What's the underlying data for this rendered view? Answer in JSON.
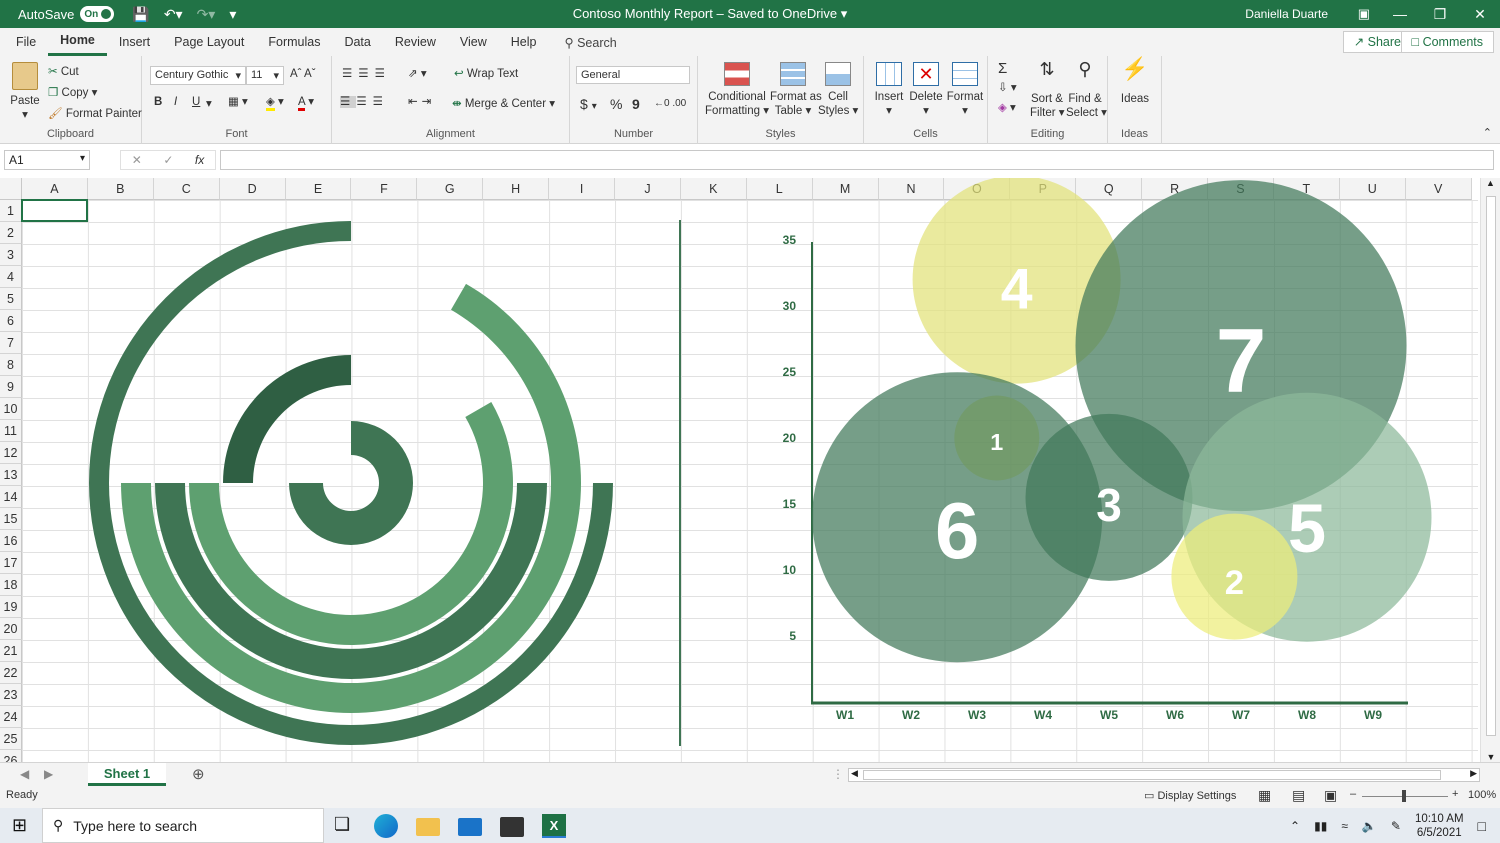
{
  "titlebar": {
    "autosave_label": "AutoSave",
    "autosave_state": "On",
    "title": "Contoso Monthly Report – Saved to OneDrive",
    "user": "Daniella Duarte"
  },
  "menu": {
    "tabs": [
      "File",
      "Home",
      "Insert",
      "Page Layout",
      "Formulas",
      "Data",
      "Review",
      "View",
      "Help"
    ],
    "active_tab": "Home",
    "search": "Search",
    "share": "Share",
    "comments": "Comments"
  },
  "ribbon": {
    "clipboard": {
      "paste": "Paste",
      "cut": "Cut",
      "copy": "Copy",
      "format_painter": "Format Painter",
      "label": "Clipboard"
    },
    "font": {
      "family": "Century Gothic",
      "size": "11",
      "bold": "B",
      "italic": "I",
      "underline": "U",
      "label": "Font"
    },
    "alignment": {
      "wrap_text": "Wrap Text",
      "merge_center": "Merge & Center",
      "label": "Alignment"
    },
    "number": {
      "format": "General",
      "currency": "$",
      "percent": "%",
      "comma": "9",
      "label": "Number"
    },
    "styles": {
      "conditional": "Conditional",
      "conditional2": "Formatting",
      "format_table": "Format as",
      "format_table2": "Table",
      "cell_styles": "Cell",
      "cell_styles2": "Styles",
      "label": "Styles"
    },
    "cells": {
      "insert": "Insert",
      "delete": "Delete",
      "format": "Format",
      "label": "Cells"
    },
    "editing": {
      "sort": "Sort &",
      "sort2": "Filter",
      "find": "Find &",
      "find2": "Select",
      "label": "Editing"
    },
    "ideas": {
      "ideas": "Ideas",
      "label": "Ideas"
    }
  },
  "formula_bar": {
    "name_box": "A1",
    "fx": "fx",
    "value": ""
  },
  "grid": {
    "columns": [
      "A",
      "B",
      "C",
      "D",
      "E",
      "F",
      "G",
      "H",
      "I",
      "J",
      "K",
      "L",
      "M",
      "N",
      "O",
      "P",
      "Q",
      "R",
      "S",
      "T",
      "U",
      "V"
    ],
    "rows": [
      "1",
      "2",
      "3",
      "4",
      "5",
      "6",
      "7",
      "8",
      "9",
      "10",
      "11",
      "12",
      "13",
      "14",
      "15",
      "16",
      "17",
      "18",
      "19",
      "20",
      "21",
      "22",
      "23",
      "24",
      "25",
      "26"
    ]
  },
  "chart_data": [
    {
      "type": "radial bar",
      "series": [
        {
          "color": "#3f7554"
        },
        {
          "color": "#5ea070"
        },
        {
          "color": "#3f7554"
        },
        {
          "color": "#5ea070"
        },
        {
          "color": "#2f5f43"
        },
        {
          "color": "#3f7554"
        }
      ]
    },
    {
      "type": "scatter",
      "categories": [
        "W1",
        "W2",
        "W3",
        "W4",
        "W5",
        "W6",
        "W7",
        "W8",
        "W9"
      ],
      "y_ticks": [
        "5",
        "10",
        "15",
        "20",
        "25",
        "30",
        "35"
      ],
      "points": [
        {
          "label": "4",
          "x": 3.6,
          "y": 32,
          "size": 4,
          "color": "#e2e278"
        },
        {
          "label": "7",
          "x": 7.0,
          "y": 27,
          "size": 7,
          "color": "#41795a"
        },
        {
          "label": "1",
          "x": 3.3,
          "y": 20,
          "size": 1,
          "color": "#eded7a"
        },
        {
          "label": "3",
          "x": 5.0,
          "y": 15.5,
          "size": 3,
          "color": "#41795a"
        },
        {
          "label": "6",
          "x": 2.7,
          "y": 14,
          "size": 6,
          "color": "#41795a"
        },
        {
          "label": "5",
          "x": 8.0,
          "y": 14,
          "size": 5,
          "color": "#8cb89a"
        },
        {
          "label": "2",
          "x": 6.9,
          "y": 9.5,
          "size": 2,
          "color": "#eded7a"
        }
      ]
    }
  ],
  "sheets": {
    "active": "Sheet 1"
  },
  "status": {
    "ready": "Ready",
    "display_settings": "Display Settings",
    "zoom": "100%"
  },
  "taskbar": {
    "search": "Type here to search",
    "time": "10:10 AM",
    "date": "6/5/2021"
  }
}
